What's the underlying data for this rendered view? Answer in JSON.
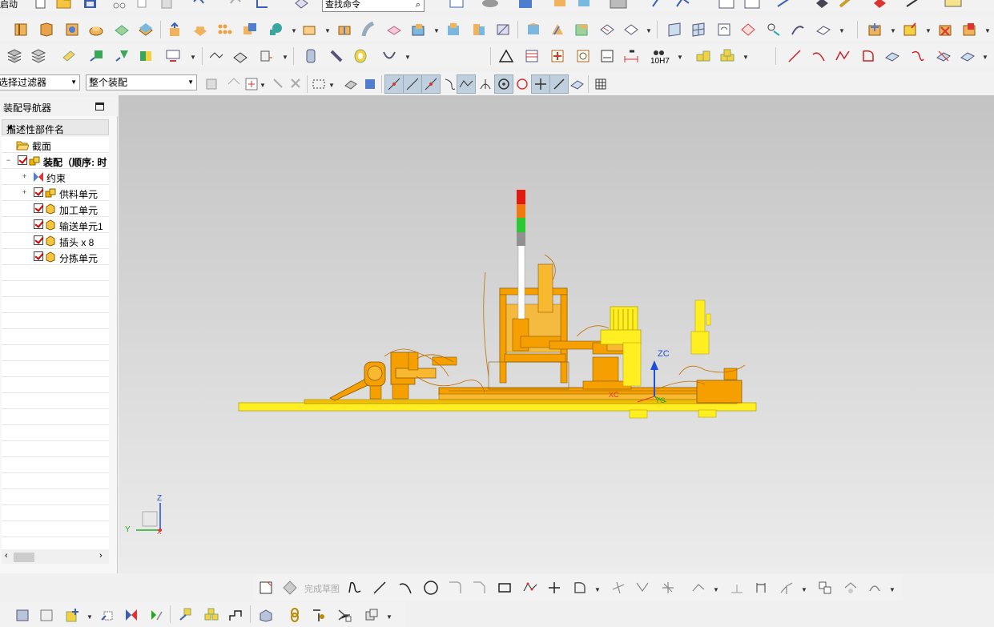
{
  "top_menu": {
    "start_label": "启动",
    "search_placeholder": "查找命令"
  },
  "selection_bar": {
    "filter_value": "选择过滤器",
    "scope_value": "整个装配"
  },
  "navigator": {
    "title": "装配导航器",
    "column_header": "描述性部件名",
    "items": [
      {
        "label": "截面",
        "level": 1
      },
      {
        "label": "装配（顺序: 时",
        "level": 0
      },
      {
        "label": "约束",
        "level": 1
      },
      {
        "label": "供料单元",
        "level": 1
      },
      {
        "label": "加工单元",
        "level": 1
      },
      {
        "label": "输送单元1",
        "level": 1
      },
      {
        "label": "插头 x 8",
        "level": 1
      },
      {
        "label": "分拣单元",
        "level": 1
      }
    ]
  },
  "viewport": {
    "wcs_z_label": "ZC",
    "wcs_y_label": "YC",
    "wcs_x_label": "XC",
    "triad_z": "Z",
    "triad_y": "Y",
    "triad_x": "X"
  },
  "sketch_bar": {
    "finish_sketch_label": "完成草图"
  },
  "toolbar_labels": {
    "tolerance": "10H7"
  },
  "colors": {
    "model_body": "#f5a000",
    "model_base": "#ffee22",
    "signal_red": "#e21b12",
    "signal_orange": "#f07a10",
    "signal_green": "#2ec832",
    "signal_gray": "#909090"
  }
}
